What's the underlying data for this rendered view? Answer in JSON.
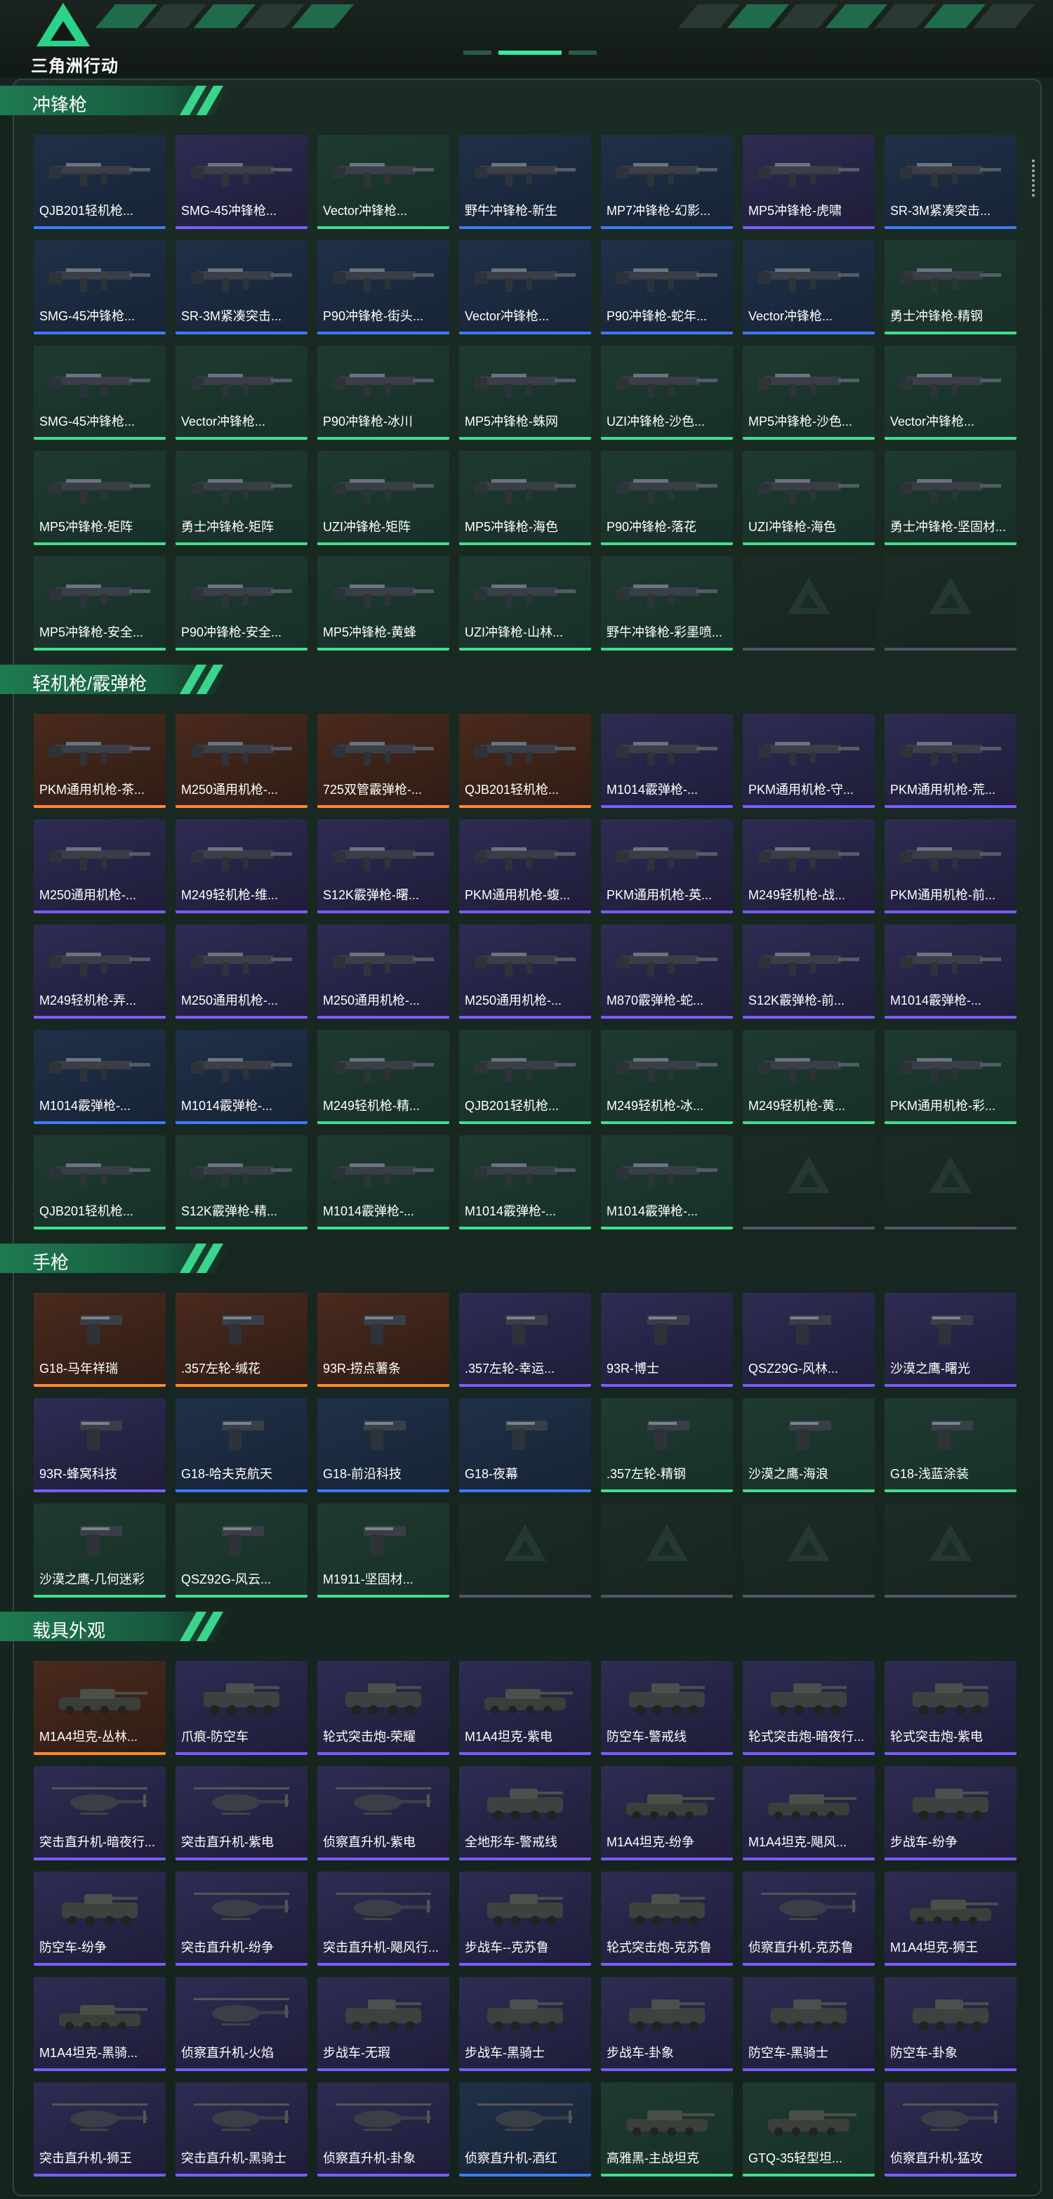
{
  "app": {
    "logo_text": "三角洲行动"
  },
  "colors": {
    "purple": "#7c5cff",
    "blue": "#3c7bff",
    "green": "#3ee08a",
    "orange": "#ff8a2a",
    "panel": "#16241e",
    "accent": "#2bd38a"
  },
  "sections": [
    {
      "title": "冲锋枪",
      "items": [
        {
          "label": "QJB201轻机枪...",
          "rarity": "blue",
          "icon": "gun-icon"
        },
        {
          "label": "SMG-45冲锋枪...",
          "rarity": "purple",
          "icon": "gun-icon"
        },
        {
          "label": "Vector冲锋枪...",
          "rarity": "green",
          "icon": "gun-icon"
        },
        {
          "label": "野牛冲锋枪-新生",
          "rarity": "blue",
          "icon": "gun-icon"
        },
        {
          "label": "MP7冲锋枪-幻影...",
          "rarity": "blue",
          "icon": "gun-icon"
        },
        {
          "label": "MP5冲锋枪-虎啸",
          "rarity": "purple",
          "icon": "gun-icon"
        },
        {
          "label": "SR-3M紧凑突击...",
          "rarity": "blue",
          "icon": "gun-icon"
        },
        {
          "label": "SMG-45冲锋枪...",
          "rarity": "blue",
          "icon": "gun-icon"
        },
        {
          "label": "SR-3M紧凑突击...",
          "rarity": "blue",
          "icon": "gun-icon"
        },
        {
          "label": "P90冲锋枪-街头...",
          "rarity": "blue",
          "icon": "gun-icon"
        },
        {
          "label": "Vector冲锋枪...",
          "rarity": "blue",
          "icon": "gun-icon"
        },
        {
          "label": "P90冲锋枪-蛇年...",
          "rarity": "blue",
          "icon": "gun-icon"
        },
        {
          "label": "Vector冲锋枪...",
          "rarity": "blue",
          "icon": "gun-icon"
        },
        {
          "label": "勇士冲锋枪-精钢",
          "rarity": "green",
          "icon": "gun-icon"
        },
        {
          "label": "SMG-45冲锋枪...",
          "rarity": "green",
          "icon": "gun-icon"
        },
        {
          "label": "Vector冲锋枪...",
          "rarity": "green",
          "icon": "gun-icon"
        },
        {
          "label": "P90冲锋枪-冰川",
          "rarity": "green",
          "icon": "gun-icon"
        },
        {
          "label": "MP5冲锋枪-蛛网",
          "rarity": "green",
          "icon": "gun-icon"
        },
        {
          "label": "UZI冲锋枪-沙色...",
          "rarity": "green",
          "icon": "gun-icon"
        },
        {
          "label": "MP5冲锋枪-沙色...",
          "rarity": "green",
          "icon": "gun-icon"
        },
        {
          "label": "Vector冲锋枪...",
          "rarity": "green",
          "icon": "gun-icon"
        },
        {
          "label": "MP5冲锋枪-矩阵",
          "rarity": "green",
          "icon": "gun-icon"
        },
        {
          "label": "勇士冲锋枪-矩阵",
          "rarity": "green",
          "icon": "gun-icon"
        },
        {
          "label": "UZI冲锋枪-矩阵",
          "rarity": "green",
          "icon": "gun-icon"
        },
        {
          "label": "MP5冲锋枪-海色",
          "rarity": "green",
          "icon": "gun-icon"
        },
        {
          "label": "P90冲锋枪-落花",
          "rarity": "green",
          "icon": "gun-icon"
        },
        {
          "label": "UZI冲锋枪-海色",
          "rarity": "green",
          "icon": "gun-icon"
        },
        {
          "label": "勇士冲锋枪-坚固材...",
          "rarity": "green",
          "icon": "gun-icon"
        },
        {
          "label": "MP5冲锋枪-安全...",
          "rarity": "green",
          "icon": "gun-icon"
        },
        {
          "label": "P90冲锋枪-安全...",
          "rarity": "green",
          "icon": "gun-icon"
        },
        {
          "label": "MP5冲锋枪-黄蜂",
          "rarity": "green",
          "icon": "gun-icon"
        },
        {
          "label": "UZI冲锋枪-山林...",
          "rarity": "green",
          "icon": "gun-icon"
        },
        {
          "label": "野牛冲锋枪-彩墨喷...",
          "rarity": "green",
          "icon": "gun-icon"
        },
        {
          "label": "",
          "rarity": "empty",
          "icon": "empty-slot-icon"
        },
        {
          "label": "",
          "rarity": "empty",
          "icon": "empty-slot-icon"
        }
      ]
    },
    {
      "title": "轻机枪/霰弹枪",
      "items": [
        {
          "label": "PKM通用机枪-茶...",
          "rarity": "orange",
          "icon": "gun-icon"
        },
        {
          "label": "M250通用机枪-...",
          "rarity": "orange",
          "icon": "gun-icon"
        },
        {
          "label": "725双管霰弹枪-...",
          "rarity": "orange",
          "icon": "gun-icon"
        },
        {
          "label": "QJB201轻机枪...",
          "rarity": "orange",
          "icon": "gun-icon"
        },
        {
          "label": "M1014霰弹枪-...",
          "rarity": "purple",
          "icon": "gun-icon"
        },
        {
          "label": "PKM通用机枪-守...",
          "rarity": "purple",
          "icon": "gun-icon"
        },
        {
          "label": "PKM通用机枪-荒...",
          "rarity": "purple",
          "icon": "gun-icon"
        },
        {
          "label": "M250通用机枪-...",
          "rarity": "purple",
          "icon": "gun-icon"
        },
        {
          "label": "M249轻机枪-维...",
          "rarity": "purple",
          "icon": "gun-icon"
        },
        {
          "label": "S12K霰弹枪-曙...",
          "rarity": "purple",
          "icon": "gun-icon"
        },
        {
          "label": "PKM通用机枪-蝮...",
          "rarity": "purple",
          "icon": "gun-icon"
        },
        {
          "label": "PKM通用机枪-英...",
          "rarity": "purple",
          "icon": "gun-icon"
        },
        {
          "label": "M249轻机枪-战...",
          "rarity": "purple",
          "icon": "gun-icon"
        },
        {
          "label": "PKM通用机枪-前...",
          "rarity": "purple",
          "icon": "gun-icon"
        },
        {
          "label": "M249轻机枪-弄...",
          "rarity": "purple",
          "icon": "gun-icon"
        },
        {
          "label": "M250通用机枪-...",
          "rarity": "purple",
          "icon": "gun-icon"
        },
        {
          "label": "M250通用机枪-...",
          "rarity": "purple",
          "icon": "gun-icon"
        },
        {
          "label": "M250通用机枪-...",
          "rarity": "purple",
          "icon": "gun-icon"
        },
        {
          "label": "M870霰弹枪-蛇...",
          "rarity": "purple",
          "icon": "gun-icon"
        },
        {
          "label": "S12K霰弹枪-前...",
          "rarity": "purple",
          "icon": "gun-icon"
        },
        {
          "label": "M1014霰弹枪-...",
          "rarity": "purple",
          "icon": "gun-icon"
        },
        {
          "label": "M1014霰弹枪-...",
          "rarity": "blue",
          "icon": "gun-icon"
        },
        {
          "label": "M1014霰弹枪-...",
          "rarity": "blue",
          "icon": "gun-icon"
        },
        {
          "label": "M249轻机枪-精...",
          "rarity": "green",
          "icon": "gun-icon"
        },
        {
          "label": "QJB201轻机枪...",
          "rarity": "green",
          "icon": "gun-icon"
        },
        {
          "label": "M249轻机枪-冰...",
          "rarity": "green",
          "icon": "gun-icon"
        },
        {
          "label": "M249轻机枪-黄...",
          "rarity": "green",
          "icon": "gun-icon"
        },
        {
          "label": "PKM通用机枪-彩...",
          "rarity": "green",
          "icon": "gun-icon"
        },
        {
          "label": "QJB201轻机枪...",
          "rarity": "green",
          "icon": "gun-icon"
        },
        {
          "label": "S12K霰弹枪-精...",
          "rarity": "green",
          "icon": "gun-icon"
        },
        {
          "label": "M1014霰弹枪-...",
          "rarity": "green",
          "icon": "gun-icon"
        },
        {
          "label": "M1014霰弹枪-...",
          "rarity": "green",
          "icon": "gun-icon"
        },
        {
          "label": "M1014霰弹枪-...",
          "rarity": "green",
          "icon": "gun-icon"
        },
        {
          "label": "",
          "rarity": "empty",
          "icon": "empty-slot-icon"
        },
        {
          "label": "",
          "rarity": "empty",
          "icon": "empty-slot-icon"
        }
      ]
    },
    {
      "title": "手枪",
      "items": [
        {
          "label": "G18-马年祥瑞",
          "rarity": "orange",
          "icon": "pistol-icon"
        },
        {
          "label": ".357左轮-缄花",
          "rarity": "orange",
          "icon": "pistol-icon"
        },
        {
          "label": "93R-捞点薯条",
          "rarity": "orange",
          "icon": "pistol-icon"
        },
        {
          "label": ".357左轮-幸运...",
          "rarity": "purple",
          "icon": "pistol-icon"
        },
        {
          "label": "93R-博士",
          "rarity": "purple",
          "icon": "pistol-icon"
        },
        {
          "label": "QSZ29G-风林...",
          "rarity": "purple",
          "icon": "pistol-icon"
        },
        {
          "label": "沙漠之鹰-曙光",
          "rarity": "purple",
          "icon": "pistol-icon"
        },
        {
          "label": "93R-蜂窝科技",
          "rarity": "purple",
          "icon": "pistol-icon"
        },
        {
          "label": "G18-哈夫克航天",
          "rarity": "blue",
          "icon": "pistol-icon"
        },
        {
          "label": "G18-前沿科技",
          "rarity": "blue",
          "icon": "pistol-icon"
        },
        {
          "label": "G18-夜幕",
          "rarity": "blue",
          "icon": "pistol-icon"
        },
        {
          "label": ".357左轮-精钢",
          "rarity": "green",
          "icon": "pistol-icon"
        },
        {
          "label": "沙漠之鹰-海浪",
          "rarity": "green",
          "icon": "pistol-icon"
        },
        {
          "label": "G18-浅蓝涂装",
          "rarity": "green",
          "icon": "pistol-icon"
        },
        {
          "label": "沙漠之鹰-几何迷彩",
          "rarity": "green",
          "icon": "pistol-icon"
        },
        {
          "label": "QSZ92G-风云...",
          "rarity": "green",
          "icon": "pistol-icon"
        },
        {
          "label": "M1911-坚固材...",
          "rarity": "green",
          "icon": "pistol-icon"
        },
        {
          "label": "",
          "rarity": "empty",
          "icon": "empty-slot-icon"
        },
        {
          "label": "",
          "rarity": "empty",
          "icon": "empty-slot-icon"
        },
        {
          "label": "",
          "rarity": "empty",
          "icon": "empty-slot-icon"
        },
        {
          "label": "",
          "rarity": "empty",
          "icon": "empty-slot-icon"
        }
      ]
    },
    {
      "title": "载具外观",
      "items": [
        {
          "label": "M1A4坦克-丛林...",
          "rarity": "orange",
          "icon": "tank-icon"
        },
        {
          "label": "爪痕-防空车",
          "rarity": "purple",
          "icon": "vehicle-icon"
        },
        {
          "label": "轮式突击炮-荣耀",
          "rarity": "purple",
          "icon": "vehicle-icon"
        },
        {
          "label": "M1A4坦克-紫电",
          "rarity": "purple",
          "icon": "tank-icon"
        },
        {
          "label": "防空车-警戒线",
          "rarity": "purple",
          "icon": "vehicle-icon"
        },
        {
          "label": "轮式突击炮-暗夜行...",
          "rarity": "purple",
          "icon": "vehicle-icon"
        },
        {
          "label": "轮式突击炮-紫电",
          "rarity": "purple",
          "icon": "vehicle-icon"
        },
        {
          "label": "突击直升机-暗夜行...",
          "rarity": "purple",
          "icon": "helicopter-icon"
        },
        {
          "label": "突击直升机-紫电",
          "rarity": "purple",
          "icon": "helicopter-icon"
        },
        {
          "label": "侦察直升机-紫电",
          "rarity": "purple",
          "icon": "helicopter-icon"
        },
        {
          "label": "全地形车-警戒线",
          "rarity": "purple",
          "icon": "vehicle-icon"
        },
        {
          "label": "M1A4坦克-纷争",
          "rarity": "purple",
          "icon": "tank-icon"
        },
        {
          "label": "M1A4坦克-飓风...",
          "rarity": "purple",
          "icon": "tank-icon"
        },
        {
          "label": "步战车-纷争",
          "rarity": "purple",
          "icon": "vehicle-icon"
        },
        {
          "label": "防空车-纷争",
          "rarity": "purple",
          "icon": "vehicle-icon"
        },
        {
          "label": "突击直升机-纷争",
          "rarity": "purple",
          "icon": "helicopter-icon"
        },
        {
          "label": "突击直升机-飓风行...",
          "rarity": "purple",
          "icon": "helicopter-icon"
        },
        {
          "label": "步战车--克苏鲁",
          "rarity": "purple",
          "icon": "vehicle-icon"
        },
        {
          "label": "轮式突击炮-克苏鲁",
          "rarity": "purple",
          "icon": "vehicle-icon"
        },
        {
          "label": "侦察直升机-克苏鲁",
          "rarity": "purple",
          "icon": "helicopter-icon"
        },
        {
          "label": "M1A4坦克-狮王",
          "rarity": "purple",
          "icon": "tank-icon"
        },
        {
          "label": "M1A4坦克-黑骑...",
          "rarity": "purple",
          "icon": "tank-icon"
        },
        {
          "label": "侦察直升机-火焰",
          "rarity": "purple",
          "icon": "helicopter-icon"
        },
        {
          "label": "步战车-无瑕",
          "rarity": "purple",
          "icon": "vehicle-icon"
        },
        {
          "label": "步战车-黑骑士",
          "rarity": "purple",
          "icon": "vehicle-icon"
        },
        {
          "label": "步战车-卦象",
          "rarity": "purple",
          "icon": "vehicle-icon"
        },
        {
          "label": "防空车-黑骑士",
          "rarity": "purple",
          "icon": "vehicle-icon"
        },
        {
          "label": "防空车-卦象",
          "rarity": "purple",
          "icon": "vehicle-icon"
        },
        {
          "label": "突击直升机-狮王",
          "rarity": "purple",
          "icon": "helicopter-icon"
        },
        {
          "label": "突击直升机-黑骑士",
          "rarity": "purple",
          "icon": "helicopter-icon"
        },
        {
          "label": "侦察直升机-卦象",
          "rarity": "purple",
          "icon": "helicopter-icon"
        },
        {
          "label": "侦察直升机-酒红",
          "rarity": "blue",
          "icon": "helicopter-icon"
        },
        {
          "label": "高雅黑-主战坦克",
          "rarity": "green",
          "icon": "tank-icon"
        },
        {
          "label": "GTQ-35轻型坦...",
          "rarity": "green",
          "icon": "tank-icon"
        },
        {
          "label": "侦察直升机-猛攻",
          "rarity": "purple",
          "icon": "helicopter-icon"
        }
      ]
    }
  ]
}
